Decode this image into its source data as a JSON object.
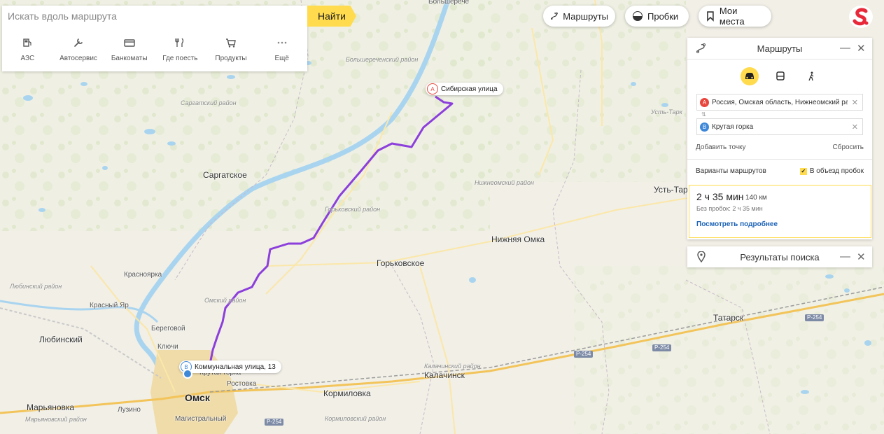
{
  "search": {
    "placeholder": "Искать вдоль маршрута",
    "find_label": "Найти",
    "categories": [
      {
        "label": "АЗС",
        "icon": "gas-station-icon"
      },
      {
        "label": "Автосервис",
        "icon": "wrench-icon"
      },
      {
        "label": "Банкоматы",
        "icon": "atm-icon"
      },
      {
        "label": "Где поесть",
        "icon": "fork-knife-icon"
      },
      {
        "label": "Продукты",
        "icon": "cart-icon"
      },
      {
        "label": "Ещё",
        "icon": "more-icon"
      }
    ]
  },
  "topbar": {
    "routes_label": "Маршруты",
    "traffic_label": "Пробки",
    "places_label": "Мои места"
  },
  "routes_panel": {
    "title": "Маршруты",
    "from_badge": "A",
    "from": "Россия, Омская область, Нижнеомский район",
    "to_badge": "B",
    "to": "Крутая горка",
    "add_point": "Добавить точку",
    "reset": "Сбросить",
    "variants_label": "Варианты маршрутов",
    "avoid_traffic_label": "В объезд пробок",
    "avoid_traffic_checked": true,
    "route": {
      "duration": "2 ч 35 мин",
      "distance": "140 км",
      "no_traffic": "Без пробок: 2 ч 35 мин",
      "details_link": "Посмотреть подробнее"
    }
  },
  "results_panel": {
    "title": "Результаты поиска"
  },
  "map": {
    "start_marker": {
      "badge": "A",
      "label": "Сибирская улица"
    },
    "end_marker": {
      "badge": "B",
      "label": "Коммунальная улица, 13"
    },
    "route_color": "#8c3fdb",
    "places": {
      "bolsherech": "Большерече",
      "bolsherech_district": "Большереченский район",
      "sargat_district": "Саргатский район",
      "sargatskoe": "Саргатское",
      "gorkovsky_district": "Горьковский район",
      "nizhneomsky_district": "Нижнеомский район",
      "nizhnyaya_omka": "Нижняя Омка",
      "gorkovskoe": "Горьковское",
      "krasnoyarka": "Красноярка",
      "krasny_yar": "Красный Яр",
      "lyubinsky_district": "Любинский район",
      "omsky_district": "Омский район",
      "beregovoy": "Береговой",
      "klyuchi": "Ключи",
      "lyubinsky": "Любинский",
      "krutaya_gorka": "Крутая горка",
      "rostovka": "Ростовка",
      "kalachinsk_district": "Калачинский район",
      "kalachinsk": "Калачинск",
      "kormilovka": "Кормиловка",
      "kormilovsky_district": "Кормиловский район",
      "omsk": "Омск",
      "maryanovka": "Марьяновка",
      "maryanovsky_district": "Марьяновский район",
      "luzino": "Лузино",
      "magistralny": "Магистральный",
      "tatarsk": "Татарск",
      "ust_tarka": "Усть-Тар",
      "ust_tarka_district": "Усть-Тарк",
      "hwy_p254": "Р-254"
    }
  },
  "colors": {
    "accent": "#ffdb4d",
    "route": "#8c3fdb",
    "link": "#1a61b6",
    "marker_a": "#e8453c",
    "marker_b": "#3f88d8"
  }
}
